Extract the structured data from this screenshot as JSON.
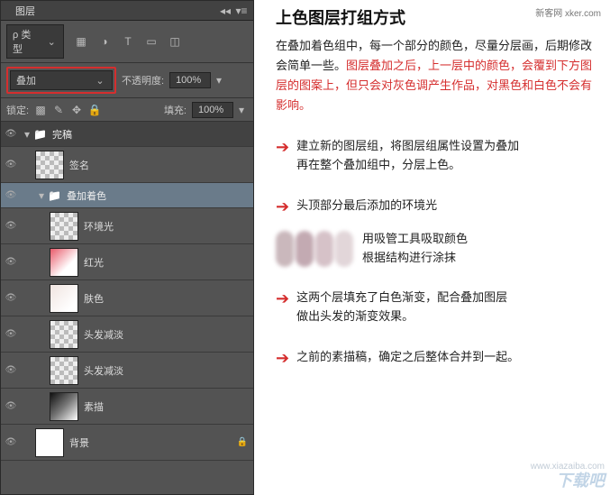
{
  "panel": {
    "tab": "图层",
    "kind_label": "ρ 类型",
    "blend_mode": "叠加",
    "opacity_label": "不透明度:",
    "opacity_value": "100%",
    "lock_label": "锁定:",
    "fill_label": "填充:",
    "fill_value": "100%"
  },
  "layers": [
    {
      "type": "group",
      "name": "完稿",
      "indent": 0,
      "expanded": true
    },
    {
      "type": "layer",
      "name": "签名",
      "indent": 1,
      "thumb": "checker"
    },
    {
      "type": "group",
      "name": "叠加着色",
      "indent": 1,
      "expanded": true,
      "selected": true
    },
    {
      "type": "layer",
      "name": "环境光",
      "indent": 2,
      "thumb": "checker"
    },
    {
      "type": "layer",
      "name": "红光",
      "indent": 2,
      "thumb": "red"
    },
    {
      "type": "layer",
      "name": "肤色",
      "indent": 2,
      "thumb": "pale"
    },
    {
      "type": "layer",
      "name": "头发减淡",
      "indent": 2,
      "thumb": "checker"
    },
    {
      "type": "layer",
      "name": "头发减淡",
      "indent": 2,
      "thumb": "checker"
    },
    {
      "type": "layer",
      "name": "素描",
      "indent": 2,
      "thumb": "sketch"
    },
    {
      "type": "layer",
      "name": "背景",
      "indent": 1,
      "thumb": "white",
      "locked": true
    }
  ],
  "ann": {
    "title": "上色图层打组方式",
    "watermark": "新客网 xker.com",
    "para_black": "在叠加着色组中，每一个部分的颜色，尽量分层画，后期修改会简单一些。",
    "para_red": "图层叠加之后，上一层中的颜色，会覆到下方图层的图案上，但只会对灰色调产生作品，对黑色和白色不会有影响。",
    "n1a": "建立新的图层组，将图层组属性设置为叠加",
    "n1b": "再在整个叠加组中，分层上色。",
    "n2": "头顶部分最后添加的环境光",
    "n3a": "用吸管工具吸取颜色",
    "n3b": "根据结构进行涂抹",
    "n4a": "这两个层填充了白色渐变，配合叠加图层",
    "n4b": "做出头发的渐变效果。",
    "n5": "之前的素描稿，确定之后整体合并到一起。",
    "bottom_url": "www.xiazaiba.com",
    "bottom_brand": "下载吧"
  },
  "swatches": [
    "#b39aa0",
    "#a98691",
    "#c4a8b0",
    "#d5c4c9"
  ]
}
